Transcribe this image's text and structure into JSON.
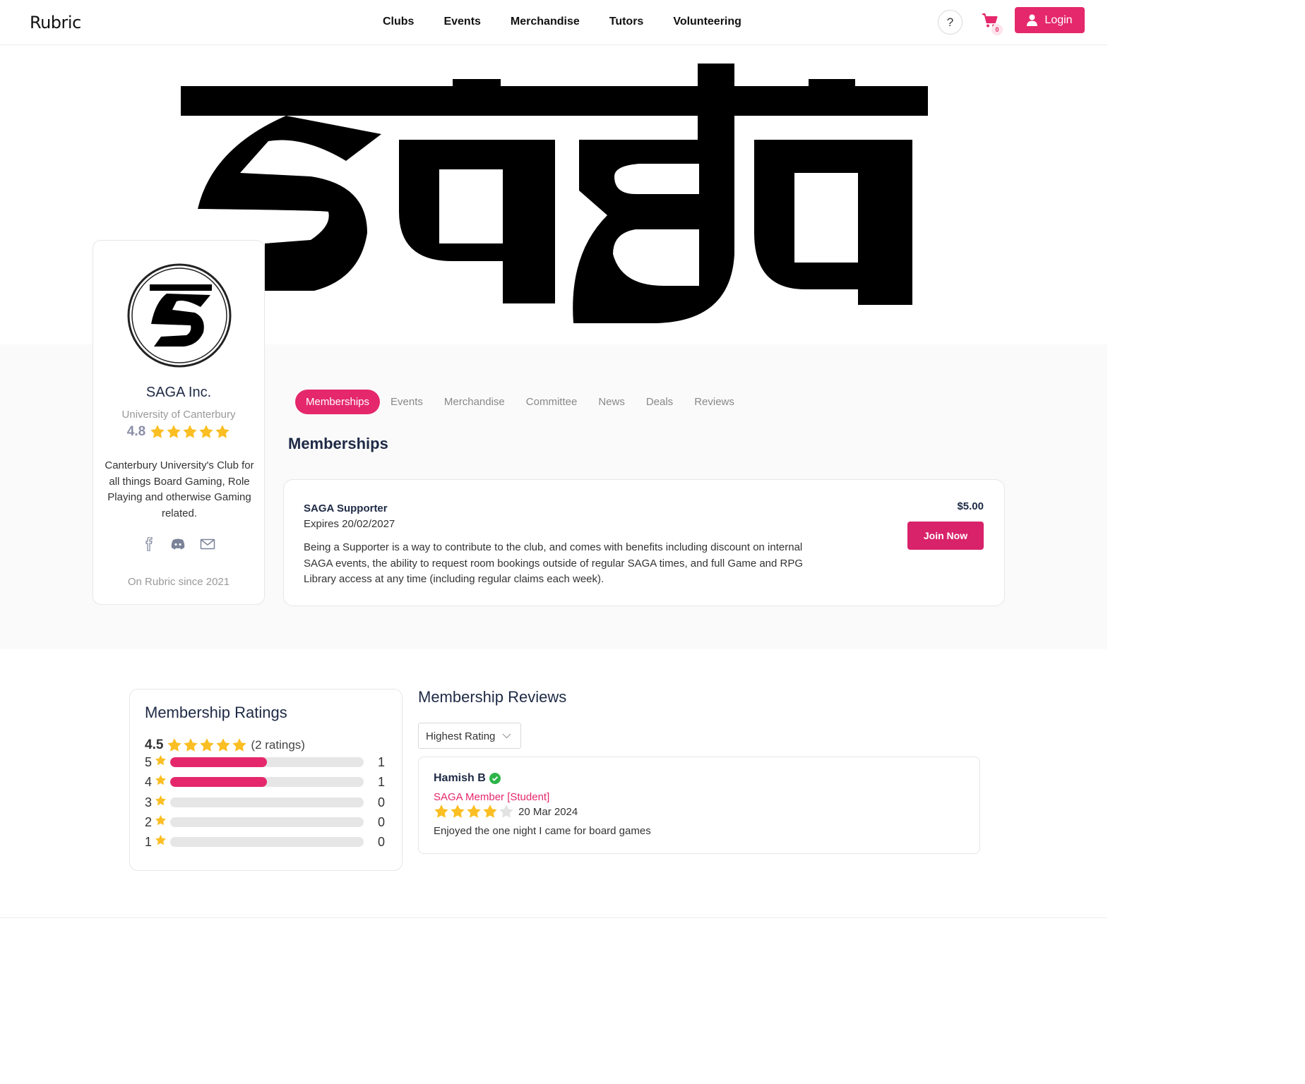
{
  "header": {
    "brand": "Rubric",
    "nav": [
      "Clubs",
      "Events",
      "Merchandise",
      "Tutors",
      "Volunteering"
    ],
    "help_label": "?",
    "cart_count": "0",
    "login_label": "Login",
    "accent_color": "#e5286b"
  },
  "profile": {
    "name": "SAGA Inc.",
    "university": "University of Canterbury",
    "rating": "4.8",
    "description": "Canterbury University's Club for all things Board Gaming, Role Playing and otherwise Gaming related.",
    "socials": [
      "facebook-icon",
      "discord-icon",
      "mail-icon"
    ],
    "since": "On Rubric since 2021"
  },
  "tabs": [
    "Memberships",
    "Events",
    "Merchandise",
    "Committee",
    "News",
    "Deals",
    "Reviews"
  ],
  "memberships": {
    "title": "Memberships",
    "items": [
      {
        "name": "SAGA Supporter",
        "expires": "Expires 20/02/2027",
        "description": "Being a Supporter is a way to contribute to the club, and comes with benefits including discount on internal SAGA events, the ability to request room bookings outside of regular SAGA times, and full Game and RPG Library access at any time (including regular claims each week).",
        "price": "$5.00",
        "button": "Join Now"
      }
    ]
  },
  "ratings": {
    "title": "Membership Ratings",
    "average": "4.5",
    "count_label": "(2 ratings)",
    "rows": [
      {
        "label": "5",
        "count": "1",
        "fraction": 0.5
      },
      {
        "label": "4",
        "count": "1",
        "fraction": 0.5
      },
      {
        "label": "3",
        "count": "0",
        "fraction": 0
      },
      {
        "label": "2",
        "count": "0",
        "fraction": 0
      },
      {
        "label": "1",
        "count": "0",
        "fraction": 0
      }
    ]
  },
  "reviews": {
    "title": "Membership Reviews",
    "sort_value": "Highest Rating",
    "items": [
      {
        "name": "Hamish B",
        "membership": "SAGA Member [Student]",
        "stars": 4,
        "date": "20 Mar 2024",
        "text": "Enjoyed the one night I came for board games"
      }
    ]
  }
}
